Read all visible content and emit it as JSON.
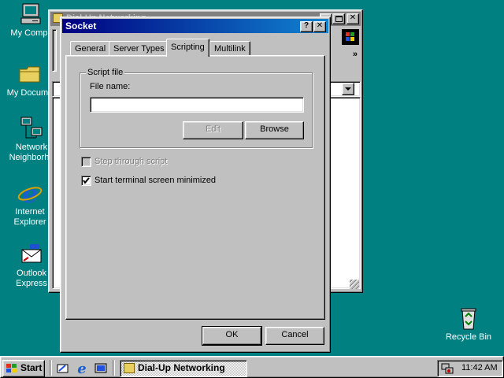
{
  "desktop": {
    "icons": [
      {
        "label": "My Compu",
        "icon": "my-computer-icon"
      },
      {
        "label": "My Docume",
        "icon": "folder-icon"
      },
      {
        "label": "Network\nNeighborho",
        "icon": "network-icon"
      },
      {
        "label": "Internet\nExplorer",
        "icon": "internet-explorer-icon"
      },
      {
        "label": "Outlook\nExpress",
        "icon": "outlook-express-icon"
      },
      {
        "label": "Recycle Bin",
        "icon": "recycle-bin-icon"
      }
    ]
  },
  "background_window": {
    "title": "Dial-Up Networking",
    "chevron": "»"
  },
  "dialog": {
    "title": "Socket",
    "help_label": "?",
    "close_label": "✕",
    "tabs": [
      {
        "label": "General",
        "active": false
      },
      {
        "label": "Server Types",
        "active": false
      },
      {
        "label": "Scripting",
        "active": true
      },
      {
        "label": "Multilink",
        "active": false
      }
    ],
    "script_group": {
      "legend": "Script file",
      "file_name_label": "File name:",
      "file_name_value": "",
      "edit_label": "Edit",
      "browse_label": "Browse"
    },
    "step_through": {
      "label": "Step through script",
      "checked": false,
      "enabled": false
    },
    "minimized": {
      "label": "Start terminal screen minimized",
      "checked": true,
      "enabled": true
    },
    "ok_label": "OK",
    "cancel_label": "Cancel"
  },
  "taskbar": {
    "start_label": "Start",
    "task_label": "Dial-Up Networking",
    "time": "11:42 AM"
  }
}
